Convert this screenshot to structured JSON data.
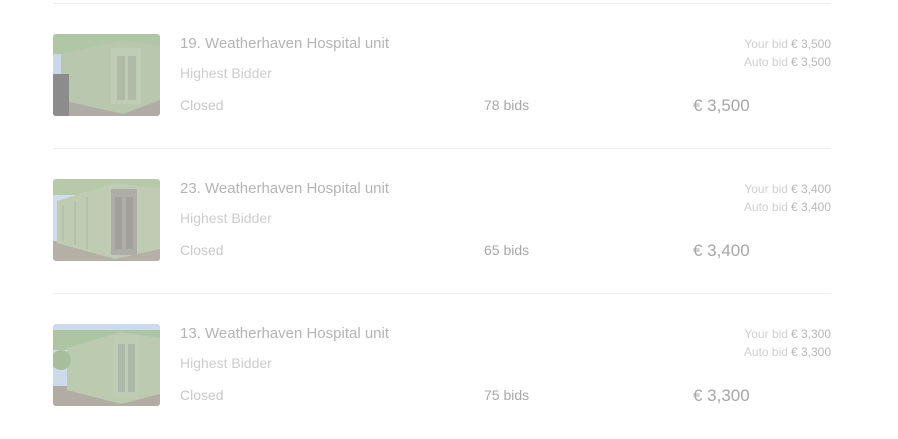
{
  "lots": [
    {
      "title": "19. Weatherhaven Hospital unit",
      "status": "Highest Bidder",
      "state": "Closed",
      "bids": "78 bids",
      "your_bid_label": "Your bid",
      "your_bid_value": "€ 3,500",
      "auto_bid_label": "Auto bid",
      "auto_bid_value": "€ 3,500",
      "price": "€ 3,500"
    },
    {
      "title": "23. Weatherhaven Hospital unit",
      "status": "Highest Bidder",
      "state": "Closed",
      "bids": "65 bids",
      "your_bid_label": "Your bid",
      "your_bid_value": "€ 3,400",
      "auto_bid_label": "Auto bid",
      "auto_bid_value": "€ 3,400",
      "price": "€ 3,400"
    },
    {
      "title": "13. Weatherhaven Hospital unit",
      "status": "Highest Bidder",
      "state": "Closed",
      "bids": "75 bids",
      "your_bid_label": "Your bid",
      "your_bid_value": "€ 3,300",
      "auto_bid_label": "Auto bid",
      "auto_bid_value": "€ 3,300",
      "price": "€ 3,300"
    }
  ]
}
